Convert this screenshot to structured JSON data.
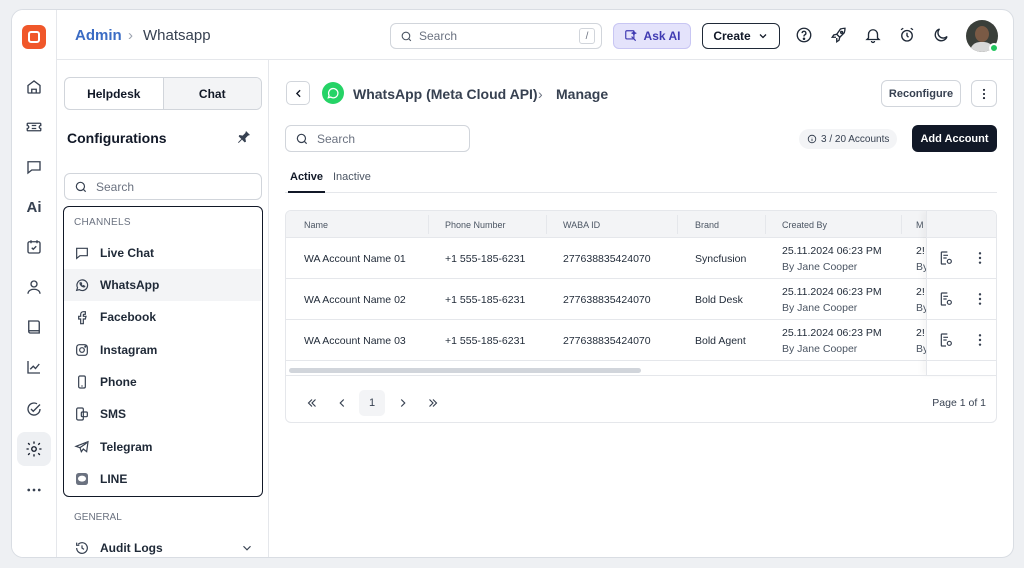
{
  "header": {
    "breadcrumb_root": "Admin",
    "breadcrumb_sep": "›",
    "breadcrumb_page": "Whatsapp",
    "search_placeholder": "Search",
    "search_shortcut": "/",
    "ask_ai_label": "Ask AI",
    "create_label": "Create",
    "icons": [
      "help-icon",
      "rocket-icon",
      "bell-icon",
      "alarm-clock-icon",
      "moon-icon"
    ],
    "user_status": "online"
  },
  "rail": {
    "items": [
      "home-icon",
      "ticket-icon",
      "chat-icon",
      "ai-icon",
      "calendar-check-icon",
      "contact-icon",
      "book-icon",
      "analytics-icon",
      "task-check-icon",
      "settings-icon",
      "more-icon"
    ],
    "ai_text": "Ai",
    "active": "settings-icon"
  },
  "config": {
    "tabs": [
      "Helpdesk",
      "Chat"
    ],
    "active_tab": "Chat",
    "title": "Configurations",
    "search_placeholder": "Search",
    "channels_heading": "CHANNELS",
    "channels": [
      {
        "label": "Live Chat",
        "icon": "chat-bubble-icon"
      },
      {
        "label": "WhatsApp",
        "icon": "whatsapp-icon"
      },
      {
        "label": "Facebook",
        "icon": "facebook-icon"
      },
      {
        "label": "Instagram",
        "icon": "instagram-icon"
      },
      {
        "label": "Phone",
        "icon": "phone-icon"
      },
      {
        "label": "SMS",
        "icon": "sms-icon"
      },
      {
        "label": "Telegram",
        "icon": "telegram-icon"
      },
      {
        "label": "LINE",
        "icon": "line-icon"
      }
    ],
    "selected_channel": "WhatsApp",
    "general_heading": "GENERAL",
    "audit_label": "Audit Logs"
  },
  "main": {
    "title": "WhatsApp (Meta Cloud API)",
    "title_sep": "›",
    "subtitle": "Manage",
    "reconfigure_label": "Reconfigure",
    "search_placeholder": "Search",
    "account_count": "3 / 20 Accounts",
    "add_account_label": "Add Account",
    "tabs": [
      "Active",
      "Inactive"
    ],
    "active_tab": "Active",
    "columns": [
      "Name",
      "Phone Number",
      "WABA ID",
      "Brand",
      "Created By",
      "M"
    ],
    "rows": [
      {
        "name": "WA Account Name 01",
        "phone": "+1 555-185-6231",
        "waba": "277638835424070",
        "brand": "Syncfusion",
        "created": "25.11.2024 06:23 PM",
        "by": "By Jane Cooper",
        "m1": "2!",
        "m2": "By"
      },
      {
        "name": "WA Account Name 02",
        "phone": "+1 555-185-6231",
        "waba": "277638835424070",
        "brand": "Bold Desk",
        "created": "25.11.2024 06:23 PM",
        "by": "By Jane Cooper",
        "m1": "2!",
        "m2": "By"
      },
      {
        "name": "WA Account Name 03",
        "phone": "+1 555-185-6231",
        "waba": "277638835424070",
        "brand": "Bold Agent",
        "created": "25.11.2024 06:23 PM",
        "by": "By Jane Cooper",
        "m1": "2!",
        "m2": "By"
      }
    ],
    "pager": {
      "current_page": "1",
      "page_info": "Page 1 of 1"
    }
  }
}
